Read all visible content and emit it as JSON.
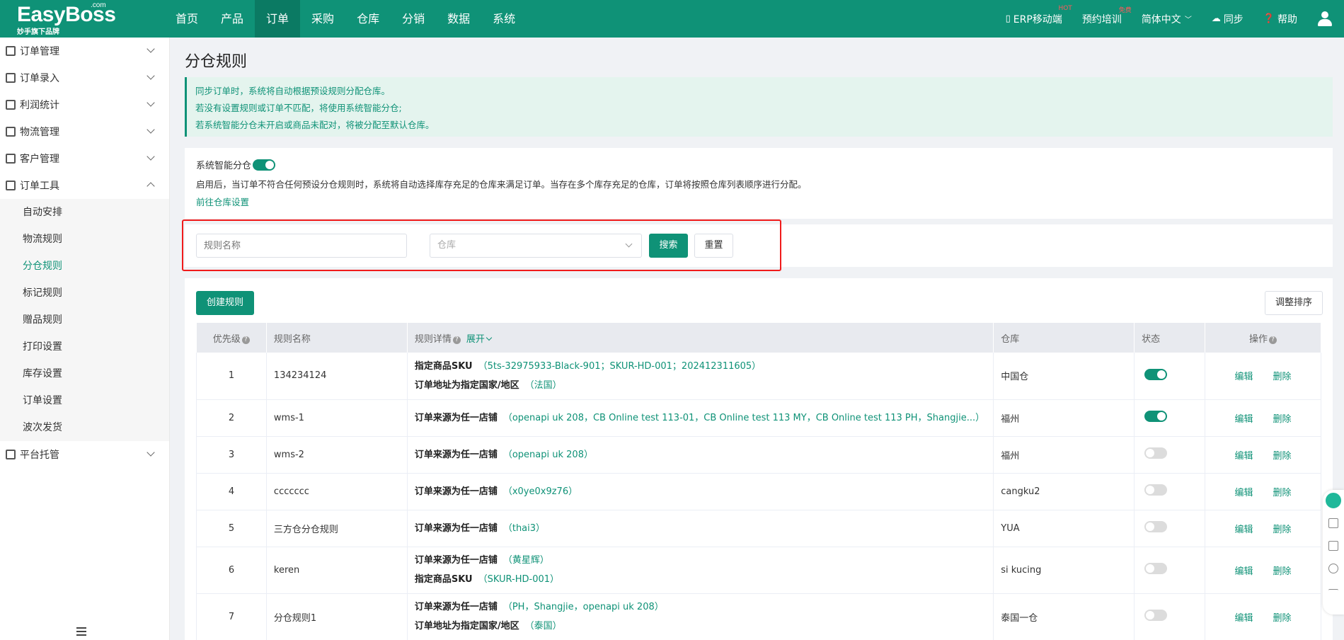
{
  "brand": {
    "name": "EasyBoss",
    "com": ".com",
    "slogan": "妙手旗下品牌"
  },
  "nav": [
    "首页",
    "产品",
    "订单",
    "采购",
    "仓库",
    "分销",
    "数据",
    "系统"
  ],
  "nav_active_index": 2,
  "right_nav": {
    "erp_mobile": "ERP移动端",
    "erp_badge": "HOT",
    "training": "预约培训",
    "training_badge": "免费",
    "language": "简体中文",
    "sync": "同步",
    "help": "帮助"
  },
  "sidebar": {
    "groups": [
      {
        "label": "订单管理",
        "icon": "order-icon"
      },
      {
        "label": "订单录入",
        "icon": "entry-icon"
      },
      {
        "label": "利润统计",
        "icon": "profit-icon"
      },
      {
        "label": "物流管理",
        "icon": "truck-icon"
      },
      {
        "label": "客户管理",
        "icon": "customer-icon"
      },
      {
        "label": "订单工具",
        "icon": "tool-icon"
      }
    ],
    "tool_items": [
      "自动安排",
      "物流规则",
      "分仓规则",
      "标记规则",
      "赠品规则",
      "打印设置",
      "库存设置",
      "订单设置",
      "波次发货"
    ],
    "active_item": "分仓规则",
    "last_group": {
      "label": "平台托管",
      "icon": "platform-icon"
    }
  },
  "page_title": "分仓规则",
  "notice": [
    "同步订单时，系统将自动根据预设规则分配仓库。",
    "若没有设置规则或订单不匹配，将使用系统智能分仓;",
    "若系统智能分仓未开启或商品未配对，将被分配至默认仓库。"
  ],
  "smart": {
    "label": "系统智能分仓",
    "enabled": true,
    "desc": "启用后，当订单不符合任何预设分仓规则时，系统将自动选择库存充足的仓库来满足订单。当存在多个库存充足的仓库，订单将按照仓库列表顺序进行分配。",
    "link": "前往仓库设置"
  },
  "search": {
    "name_placeholder": "规则名称",
    "warehouse_placeholder": "仓库",
    "search_btn": "搜索",
    "reset_btn": "重置"
  },
  "toolbar": {
    "create": "创建规则",
    "reorder": "调整排序"
  },
  "table": {
    "headers": {
      "priority": "优先级",
      "name": "规则名称",
      "detail": "规则详情",
      "expand": "展开",
      "warehouse": "仓库",
      "status": "状态",
      "ops": "操作"
    },
    "edit": "编辑",
    "delete": "删除",
    "rows": [
      {
        "priority": "1",
        "name": "134234124",
        "details": [
          {
            "label": "指定商品SKU",
            "value": "（5ts-32975933-Black-901；SKUR-HD-001；202412311605）"
          },
          {
            "label": "订单地址为指定国家/地区",
            "value": "（法国）"
          }
        ],
        "warehouse": "中国仓",
        "enabled": true
      },
      {
        "priority": "2",
        "name": "wms-1",
        "details": [
          {
            "label": "订单来源为任一店铺",
            "value": "（openapi uk 208，CB Online test 113-01，CB Online test 113 MY，CB Online test 113 PH，Shangjie...）"
          }
        ],
        "warehouse": "福州",
        "enabled": true
      },
      {
        "priority": "3",
        "name": "wms-2",
        "details": [
          {
            "label": "订单来源为任一店铺",
            "value": "（openapi uk 208）"
          }
        ],
        "warehouse": "福州",
        "enabled": false
      },
      {
        "priority": "4",
        "name": "ccccccc",
        "details": [
          {
            "label": "订单来源为任一店铺",
            "value": "（x0ye0x9z76）"
          }
        ],
        "warehouse": "cangku2",
        "enabled": false
      },
      {
        "priority": "5",
        "name": "三方仓分仓规则",
        "details": [
          {
            "label": "订单来源为任一店铺",
            "value": "（thai3）"
          }
        ],
        "warehouse": "YUA",
        "enabled": false
      },
      {
        "priority": "6",
        "name": "keren",
        "details": [
          {
            "label": "订单来源为任一店铺",
            "value": "（黄星辉）"
          },
          {
            "label": "指定商品SKU",
            "value": "（SKUR-HD-001）"
          }
        ],
        "warehouse": "si kucing",
        "enabled": false
      },
      {
        "priority": "7",
        "name": "分仓规则1",
        "details": [
          {
            "label": "订单来源为任一店铺",
            "value": "（PH，Shangjie，openapi uk 208）"
          },
          {
            "label": "订单地址为指定国家/地区",
            "value": "（泰国）"
          }
        ],
        "warehouse": "泰国一仓",
        "enabled": false
      }
    ]
  },
  "colors": {
    "primary": "#0f9277",
    "highlight_box": "#f01b1b"
  }
}
